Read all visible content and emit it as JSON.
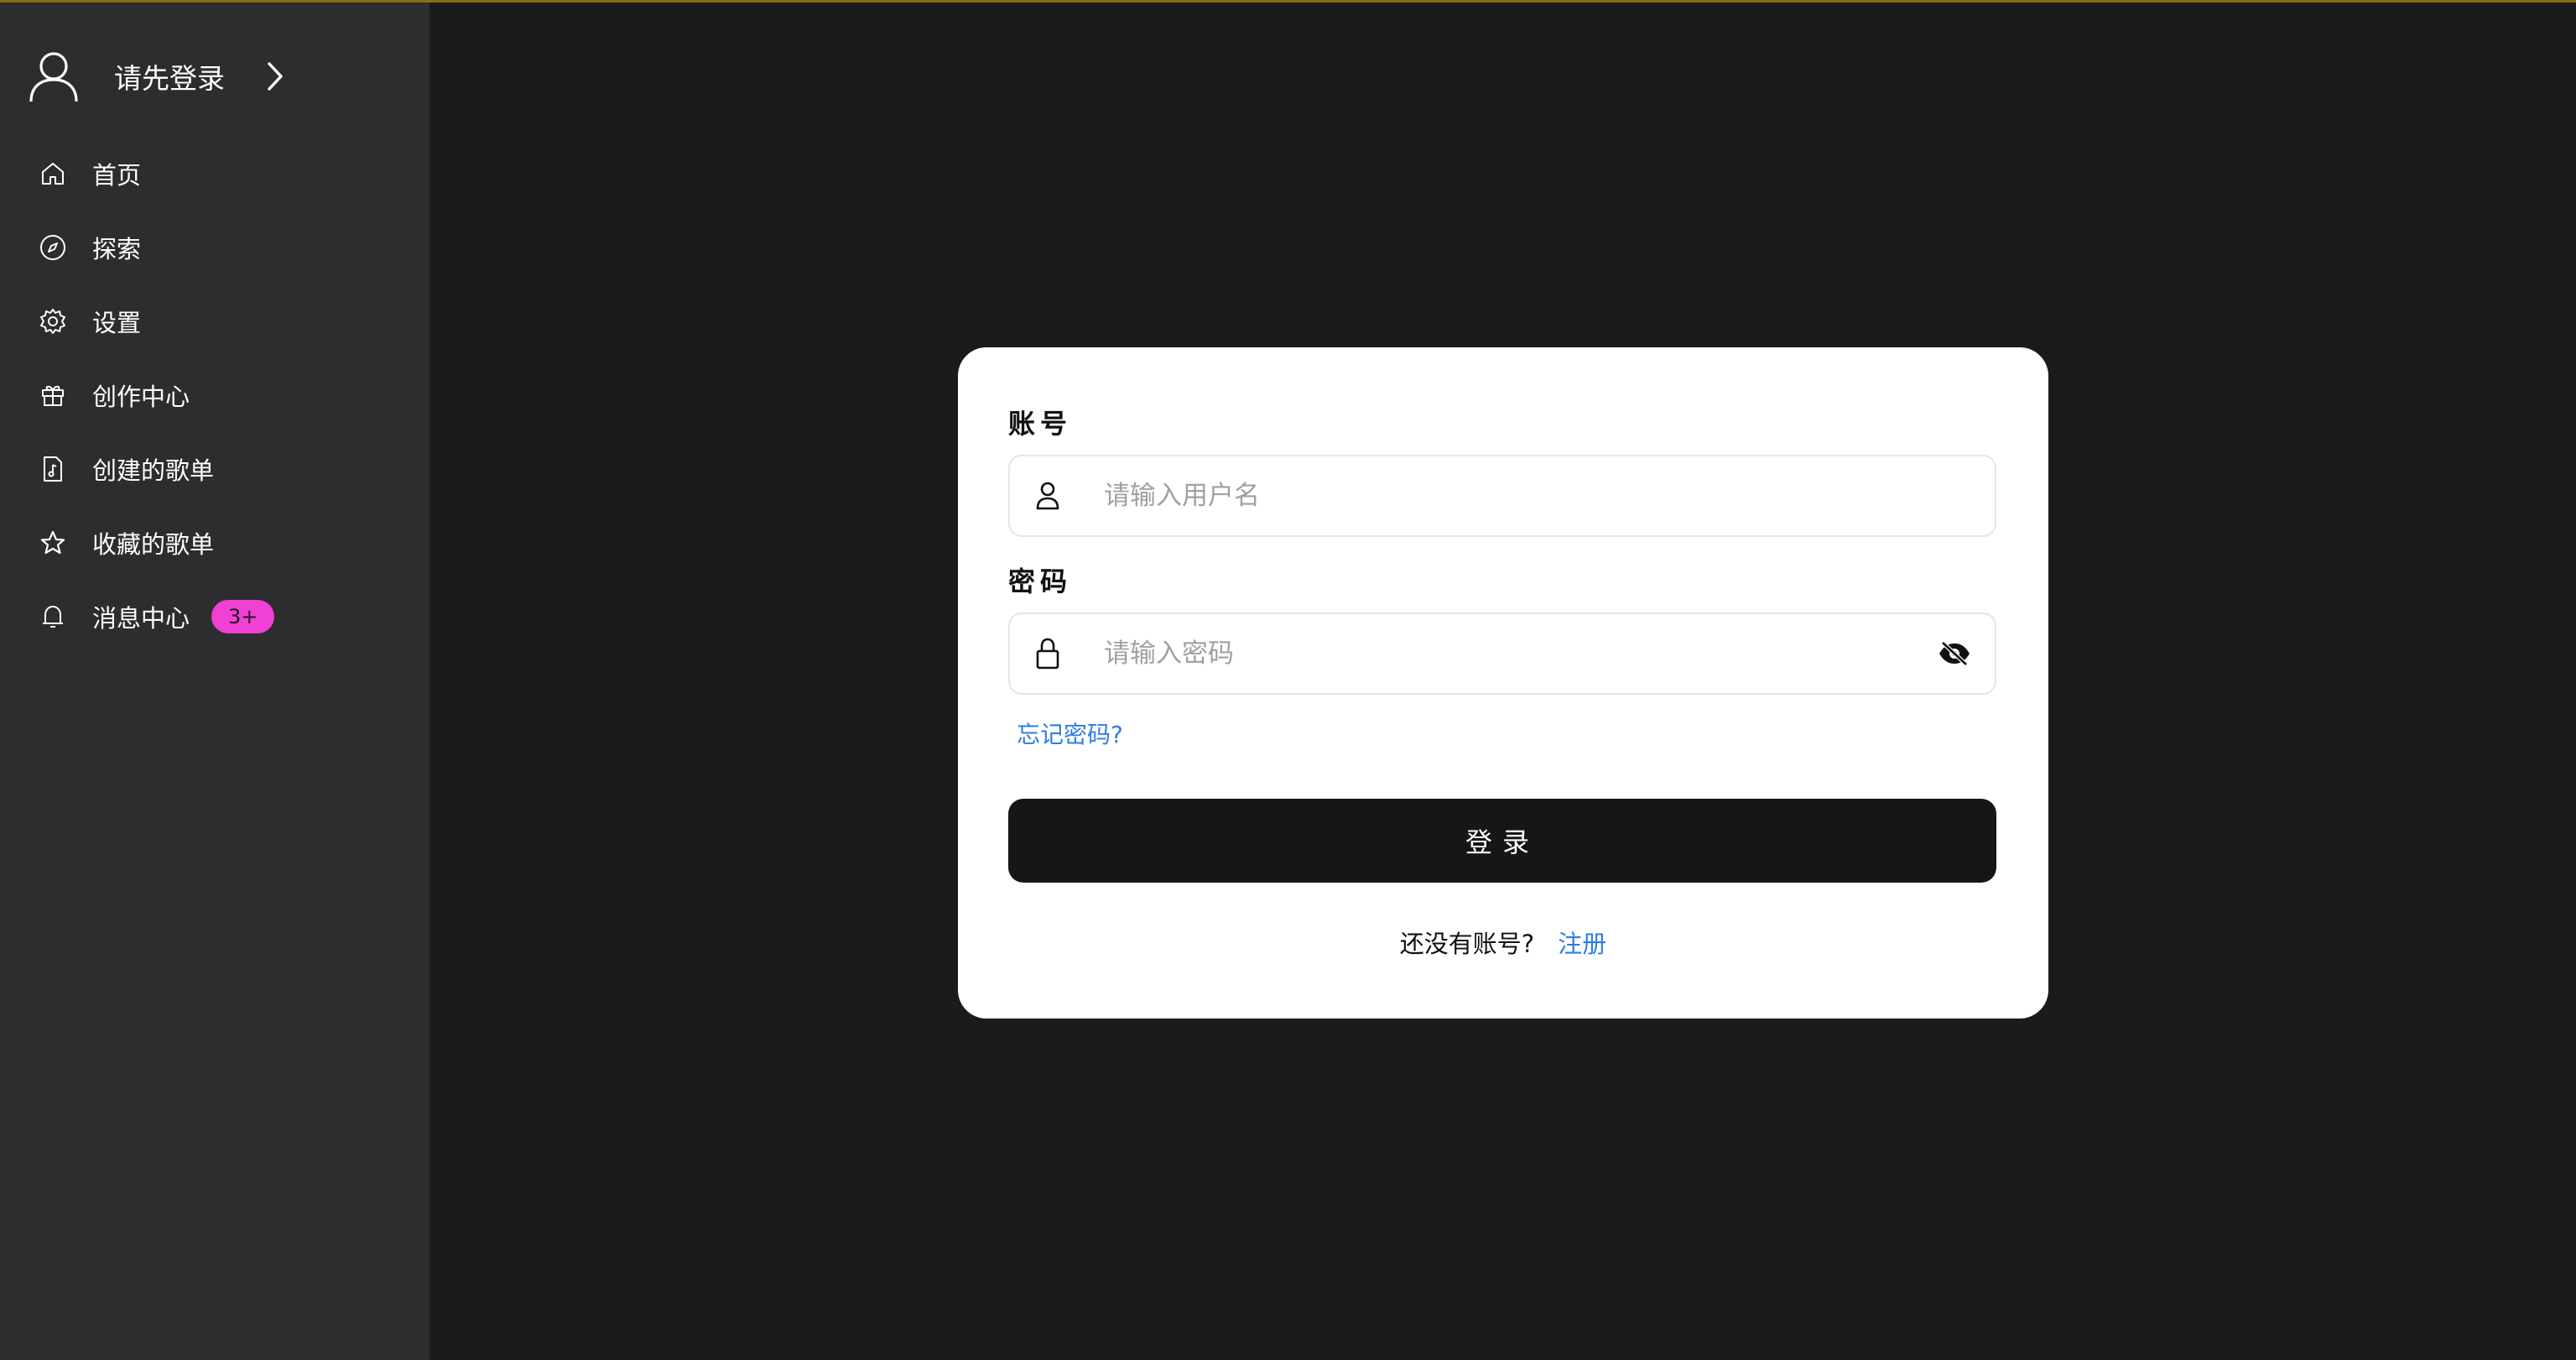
{
  "sidebar": {
    "user": {
      "login_prompt": "请先登录"
    },
    "items": [
      {
        "label": "首页",
        "icon": "home-icon"
      },
      {
        "label": "探索",
        "icon": "compass-icon"
      },
      {
        "label": "设置",
        "icon": "gear-icon"
      },
      {
        "label": "创作中心",
        "icon": "gift-icon"
      },
      {
        "label": "创建的歌单",
        "icon": "music-file-icon"
      },
      {
        "label": "收藏的歌单",
        "icon": "star-icon"
      },
      {
        "label": "消息中心",
        "icon": "bell-icon",
        "badge": "3+"
      }
    ]
  },
  "login_form": {
    "account_label": "账号",
    "username_placeholder": "请输入用户名",
    "password_label": "密码",
    "password_placeholder": "请输入密码",
    "forgot_password": "忘记密码?",
    "login_button": "登录",
    "no_account_prompt": "还没有账号?",
    "register_link": "注册"
  },
  "colors": {
    "background": "#1b1b1d",
    "sidebar": "#2d2d30",
    "badge": "#f140d4",
    "link": "#2f7de1",
    "button": "#151717",
    "top_border": "#8a6d12"
  }
}
